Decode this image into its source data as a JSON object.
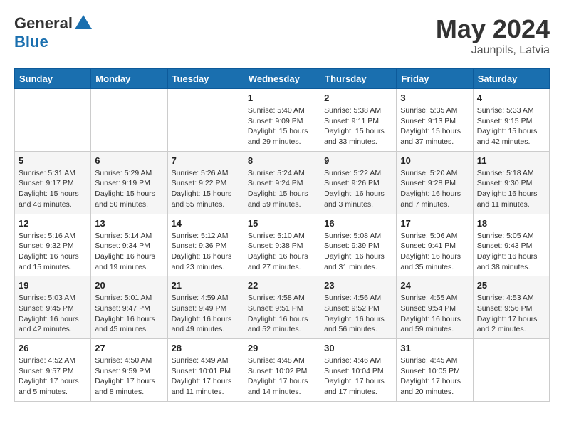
{
  "header": {
    "logo_general": "General",
    "logo_blue": "Blue",
    "month_year": "May 2024",
    "location": "Jaunpils, Latvia"
  },
  "days_of_week": [
    "Sunday",
    "Monday",
    "Tuesday",
    "Wednesday",
    "Thursday",
    "Friday",
    "Saturday"
  ],
  "weeks": [
    [
      {
        "day": "",
        "info": ""
      },
      {
        "day": "",
        "info": ""
      },
      {
        "day": "",
        "info": ""
      },
      {
        "day": "1",
        "info": "Sunrise: 5:40 AM\nSunset: 9:09 PM\nDaylight: 15 hours\nand 29 minutes."
      },
      {
        "day": "2",
        "info": "Sunrise: 5:38 AM\nSunset: 9:11 PM\nDaylight: 15 hours\nand 33 minutes."
      },
      {
        "day": "3",
        "info": "Sunrise: 5:35 AM\nSunset: 9:13 PM\nDaylight: 15 hours\nand 37 minutes."
      },
      {
        "day": "4",
        "info": "Sunrise: 5:33 AM\nSunset: 9:15 PM\nDaylight: 15 hours\nand 42 minutes."
      }
    ],
    [
      {
        "day": "5",
        "info": "Sunrise: 5:31 AM\nSunset: 9:17 PM\nDaylight: 15 hours\nand 46 minutes."
      },
      {
        "day": "6",
        "info": "Sunrise: 5:29 AM\nSunset: 9:19 PM\nDaylight: 15 hours\nand 50 minutes."
      },
      {
        "day": "7",
        "info": "Sunrise: 5:26 AM\nSunset: 9:22 PM\nDaylight: 15 hours\nand 55 minutes."
      },
      {
        "day": "8",
        "info": "Sunrise: 5:24 AM\nSunset: 9:24 PM\nDaylight: 15 hours\nand 59 minutes."
      },
      {
        "day": "9",
        "info": "Sunrise: 5:22 AM\nSunset: 9:26 PM\nDaylight: 16 hours\nand 3 minutes."
      },
      {
        "day": "10",
        "info": "Sunrise: 5:20 AM\nSunset: 9:28 PM\nDaylight: 16 hours\nand 7 minutes."
      },
      {
        "day": "11",
        "info": "Sunrise: 5:18 AM\nSunset: 9:30 PM\nDaylight: 16 hours\nand 11 minutes."
      }
    ],
    [
      {
        "day": "12",
        "info": "Sunrise: 5:16 AM\nSunset: 9:32 PM\nDaylight: 16 hours\nand 15 minutes."
      },
      {
        "day": "13",
        "info": "Sunrise: 5:14 AM\nSunset: 9:34 PM\nDaylight: 16 hours\nand 19 minutes."
      },
      {
        "day": "14",
        "info": "Sunrise: 5:12 AM\nSunset: 9:36 PM\nDaylight: 16 hours\nand 23 minutes."
      },
      {
        "day": "15",
        "info": "Sunrise: 5:10 AM\nSunset: 9:38 PM\nDaylight: 16 hours\nand 27 minutes."
      },
      {
        "day": "16",
        "info": "Sunrise: 5:08 AM\nSunset: 9:39 PM\nDaylight: 16 hours\nand 31 minutes."
      },
      {
        "day": "17",
        "info": "Sunrise: 5:06 AM\nSunset: 9:41 PM\nDaylight: 16 hours\nand 35 minutes."
      },
      {
        "day": "18",
        "info": "Sunrise: 5:05 AM\nSunset: 9:43 PM\nDaylight: 16 hours\nand 38 minutes."
      }
    ],
    [
      {
        "day": "19",
        "info": "Sunrise: 5:03 AM\nSunset: 9:45 PM\nDaylight: 16 hours\nand 42 minutes."
      },
      {
        "day": "20",
        "info": "Sunrise: 5:01 AM\nSunset: 9:47 PM\nDaylight: 16 hours\nand 45 minutes."
      },
      {
        "day": "21",
        "info": "Sunrise: 4:59 AM\nSunset: 9:49 PM\nDaylight: 16 hours\nand 49 minutes."
      },
      {
        "day": "22",
        "info": "Sunrise: 4:58 AM\nSunset: 9:51 PM\nDaylight: 16 hours\nand 52 minutes."
      },
      {
        "day": "23",
        "info": "Sunrise: 4:56 AM\nSunset: 9:52 PM\nDaylight: 16 hours\nand 56 minutes."
      },
      {
        "day": "24",
        "info": "Sunrise: 4:55 AM\nSunset: 9:54 PM\nDaylight: 16 hours\nand 59 minutes."
      },
      {
        "day": "25",
        "info": "Sunrise: 4:53 AM\nSunset: 9:56 PM\nDaylight: 17 hours\nand 2 minutes."
      }
    ],
    [
      {
        "day": "26",
        "info": "Sunrise: 4:52 AM\nSunset: 9:57 PM\nDaylight: 17 hours\nand 5 minutes."
      },
      {
        "day": "27",
        "info": "Sunrise: 4:50 AM\nSunset: 9:59 PM\nDaylight: 17 hours\nand 8 minutes."
      },
      {
        "day": "28",
        "info": "Sunrise: 4:49 AM\nSunset: 10:01 PM\nDaylight: 17 hours\nand 11 minutes."
      },
      {
        "day": "29",
        "info": "Sunrise: 4:48 AM\nSunset: 10:02 PM\nDaylight: 17 hours\nand 14 minutes."
      },
      {
        "day": "30",
        "info": "Sunrise: 4:46 AM\nSunset: 10:04 PM\nDaylight: 17 hours\nand 17 minutes."
      },
      {
        "day": "31",
        "info": "Sunrise: 4:45 AM\nSunset: 10:05 PM\nDaylight: 17 hours\nand 20 minutes."
      },
      {
        "day": "",
        "info": ""
      }
    ]
  ]
}
